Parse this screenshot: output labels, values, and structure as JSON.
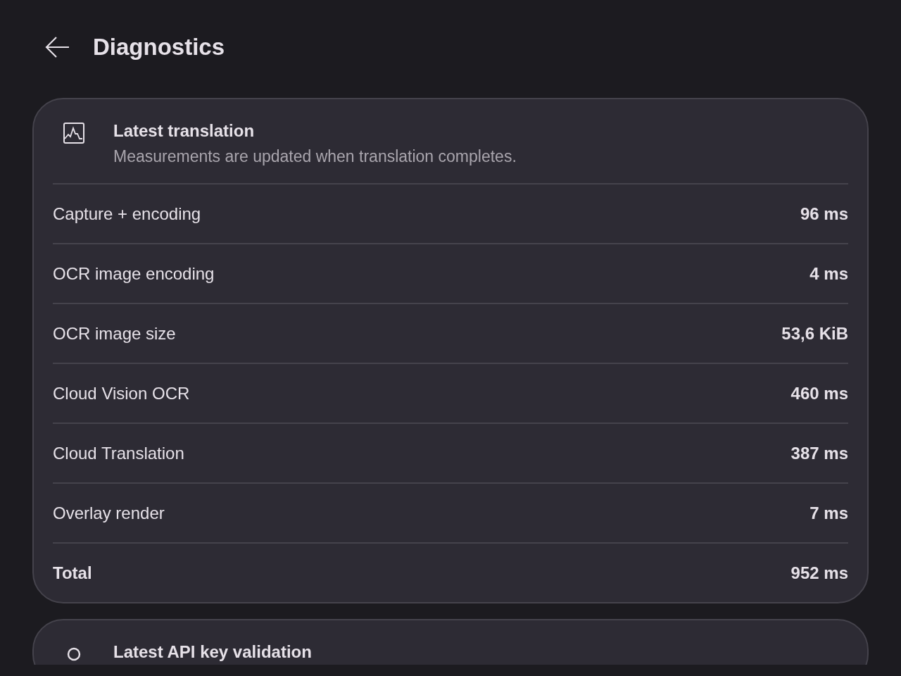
{
  "header": {
    "title": "Diagnostics"
  },
  "cards": [
    {
      "title": "Latest translation",
      "subtitle": "Measurements are updated when translation completes.",
      "rows": [
        {
          "kind": "measure",
          "label": "Capture + encoding",
          "value": "96 ms"
        },
        {
          "kind": "measure",
          "label": "OCR image encoding",
          "value": "4 ms"
        },
        {
          "kind": "measure",
          "label": "OCR image size",
          "value": "53,6 KiB"
        },
        {
          "kind": "measure",
          "label": "Cloud Vision OCR",
          "value": "460 ms"
        },
        {
          "kind": "measure",
          "label": "Cloud Translation",
          "value": "387 ms"
        },
        {
          "kind": "measure",
          "label": "Overlay render",
          "value": "7 ms"
        },
        {
          "kind": "total",
          "label": "Total",
          "value": "952 ms"
        }
      ]
    },
    {
      "title": "Latest API key validation"
    }
  ]
}
